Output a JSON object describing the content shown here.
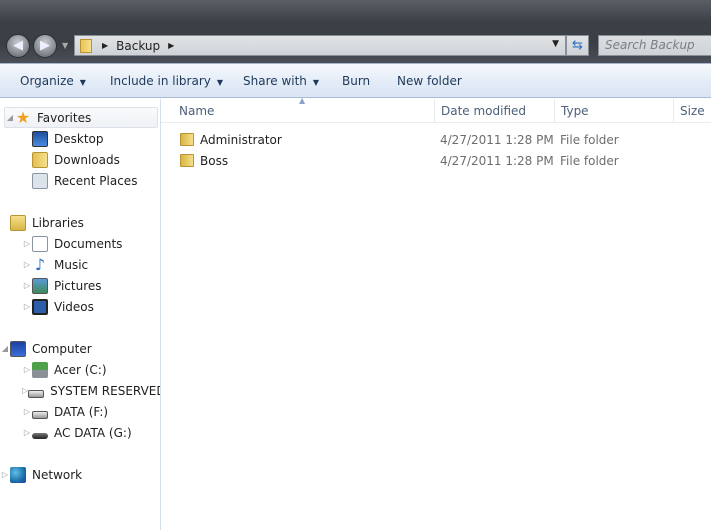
{
  "address": {
    "path": [
      "Backup"
    ],
    "search_placeholder": "Search Backup"
  },
  "toolbar": {
    "organize": "Organize",
    "include": "Include in library",
    "share": "Share with",
    "burn": "Burn",
    "new_folder": "New folder"
  },
  "nav": {
    "favorites": {
      "label": "Favorites",
      "items": [
        "Desktop",
        "Downloads",
        "Recent Places"
      ]
    },
    "libraries": {
      "label": "Libraries",
      "items": [
        "Documents",
        "Music",
        "Pictures",
        "Videos"
      ]
    },
    "computer": {
      "label": "Computer",
      "items": [
        "Acer (C:)",
        "SYSTEM RESERVED (",
        "DATA (F:)",
        "AC DATA (G:)"
      ]
    },
    "network": {
      "label": "Network"
    }
  },
  "columns": {
    "name": "Name",
    "date": "Date modified",
    "type": "Type",
    "size": "Size"
  },
  "files": [
    {
      "name": "Administrator",
      "date": "4/27/2011 1:28 PM",
      "type": "File folder"
    },
    {
      "name": "Boss",
      "date": "4/27/2011 1:28 PM",
      "type": "File folder"
    }
  ]
}
